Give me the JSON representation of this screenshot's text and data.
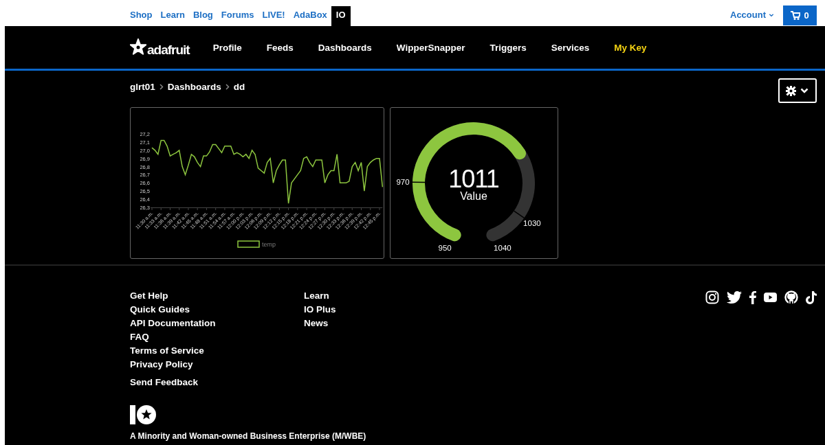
{
  "top_links": [
    {
      "label": "Shop",
      "selected": false
    },
    {
      "label": "Learn",
      "selected": false
    },
    {
      "label": "Blog",
      "selected": false
    },
    {
      "label": "Forums",
      "selected": false
    },
    {
      "label": "LIVE!",
      "selected": false
    },
    {
      "label": "AdaBox",
      "selected": false
    },
    {
      "label": "IO",
      "selected": true
    }
  ],
  "account": {
    "label": "Account",
    "cart_count": "0"
  },
  "logo": {
    "text": "adafruit"
  },
  "nav": [
    {
      "label": "Profile",
      "highlighted": false
    },
    {
      "label": "Feeds",
      "highlighted": false
    },
    {
      "label": "Dashboards",
      "highlighted": false
    },
    {
      "label": "WipperSnapper",
      "highlighted": false
    },
    {
      "label": "Triggers",
      "highlighted": false
    },
    {
      "label": "Services",
      "highlighted": false
    },
    {
      "label": "My Key",
      "highlighted": true
    }
  ],
  "breadcrumb": [
    "glrt01",
    "Dashboards",
    "dd"
  ],
  "line_block": {
    "chart_data": {
      "type": "line",
      "categories": [
        "11:30 a.m.",
        null,
        null,
        "11:33 a.m.",
        null,
        null,
        "11:36 a.m.",
        null,
        null,
        "11:39 a.m.",
        null,
        null,
        "11:42 a.m.",
        null,
        null,
        "11:45 a.m.",
        null,
        null,
        "11:48 a.m.",
        null,
        null,
        "11:51 a.m.",
        null,
        null,
        "11:54 a.m.",
        null,
        null,
        "11:57 a.m.",
        null,
        null,
        "12:00 p.m.",
        null,
        null,
        "12:03 p.m.",
        null,
        null,
        "12:06 p.m.",
        null,
        null,
        "12:09 p.m.",
        null,
        null,
        "12:12 p.m.",
        null,
        null,
        "12:15 p.m.",
        null,
        null,
        "12:18 p.m.",
        null,
        null,
        "12:21 p.m.",
        null,
        null,
        "12:24 p.m.",
        null,
        null,
        "12:27 p.m.",
        null,
        null,
        "12:30 p.m.",
        null,
        null,
        "12:33 p.m.",
        null,
        null,
        "12:36 p.m.",
        null,
        null,
        "12:39 p.m.",
        null,
        null,
        "12:42 p.m.",
        null,
        null,
        "12:45 p.m.",
        null
      ],
      "series": [
        {
          "name": "temp",
          "color": "#8dc63f",
          "values": [
            27.03,
            27.0,
            26.95,
            27.12,
            27.12,
            27.05,
            26.93,
            26.95,
            26.97,
            27.0,
            26.8,
            26.7,
            26.82,
            26.95,
            26.92,
            26.85,
            26.8,
            26.93,
            26.93,
            26.98,
            27.07,
            27.07,
            27.02,
            26.97,
            27.05,
            27.05,
            27.05,
            26.95,
            26.97,
            26.95,
            26.92,
            26.95,
            26.9,
            27.0,
            26.95,
            26.78,
            26.75,
            26.72,
            26.85,
            26.9,
            26.6,
            26.75,
            26.82,
            26.88,
            26.88,
            26.35,
            26.6,
            26.65,
            26.7,
            26.75,
            26.9,
            26.92,
            26.85,
            26.8,
            26.88,
            26.88,
            26.88,
            26.6,
            26.7,
            26.75,
            26.75,
            26.95,
            26.6,
            26.6,
            26.6,
            26.62,
            26.8,
            26.85,
            26.75,
            26.85,
            26.5,
            26.8,
            26.85,
            26.88,
            26.9,
            26.9,
            26.55
          ]
        }
      ],
      "ylim": [
        26.3,
        27.2
      ],
      "yticks": [
        {
          "value": 26.3,
          "label": "26,3"
        },
        {
          "value": 26.4,
          "label": "26,4"
        },
        {
          "value": 26.5,
          "label": "26,5"
        },
        {
          "value": 26.6,
          "label": "26,6"
        },
        {
          "value": 26.7,
          "label": "26,7"
        },
        {
          "value": 26.8,
          "label": "26,8"
        },
        {
          "value": 26.9,
          "label": "26,9"
        },
        {
          "value": 27.0,
          "label": "27,0"
        },
        {
          "value": 27.1,
          "label": "27,1"
        },
        {
          "value": 27.2,
          "label": "27,2"
        }
      ]
    }
  },
  "gauge": {
    "value": "1011",
    "label": "Value",
    "min": "950",
    "max": "1040",
    "ticks": [
      "970",
      "1030"
    ]
  },
  "footer": {
    "col1": [
      "Get Help",
      "Quick Guides",
      "API Documentation",
      "FAQ",
      "Terms of Service",
      "Privacy Policy"
    ],
    "feedback": "Send Feedback",
    "col2": [
      "Learn",
      "IO Plus",
      "News"
    ],
    "tagline": "A Minority and Woman-owned Business Enterprise (M/WBE)"
  }
}
